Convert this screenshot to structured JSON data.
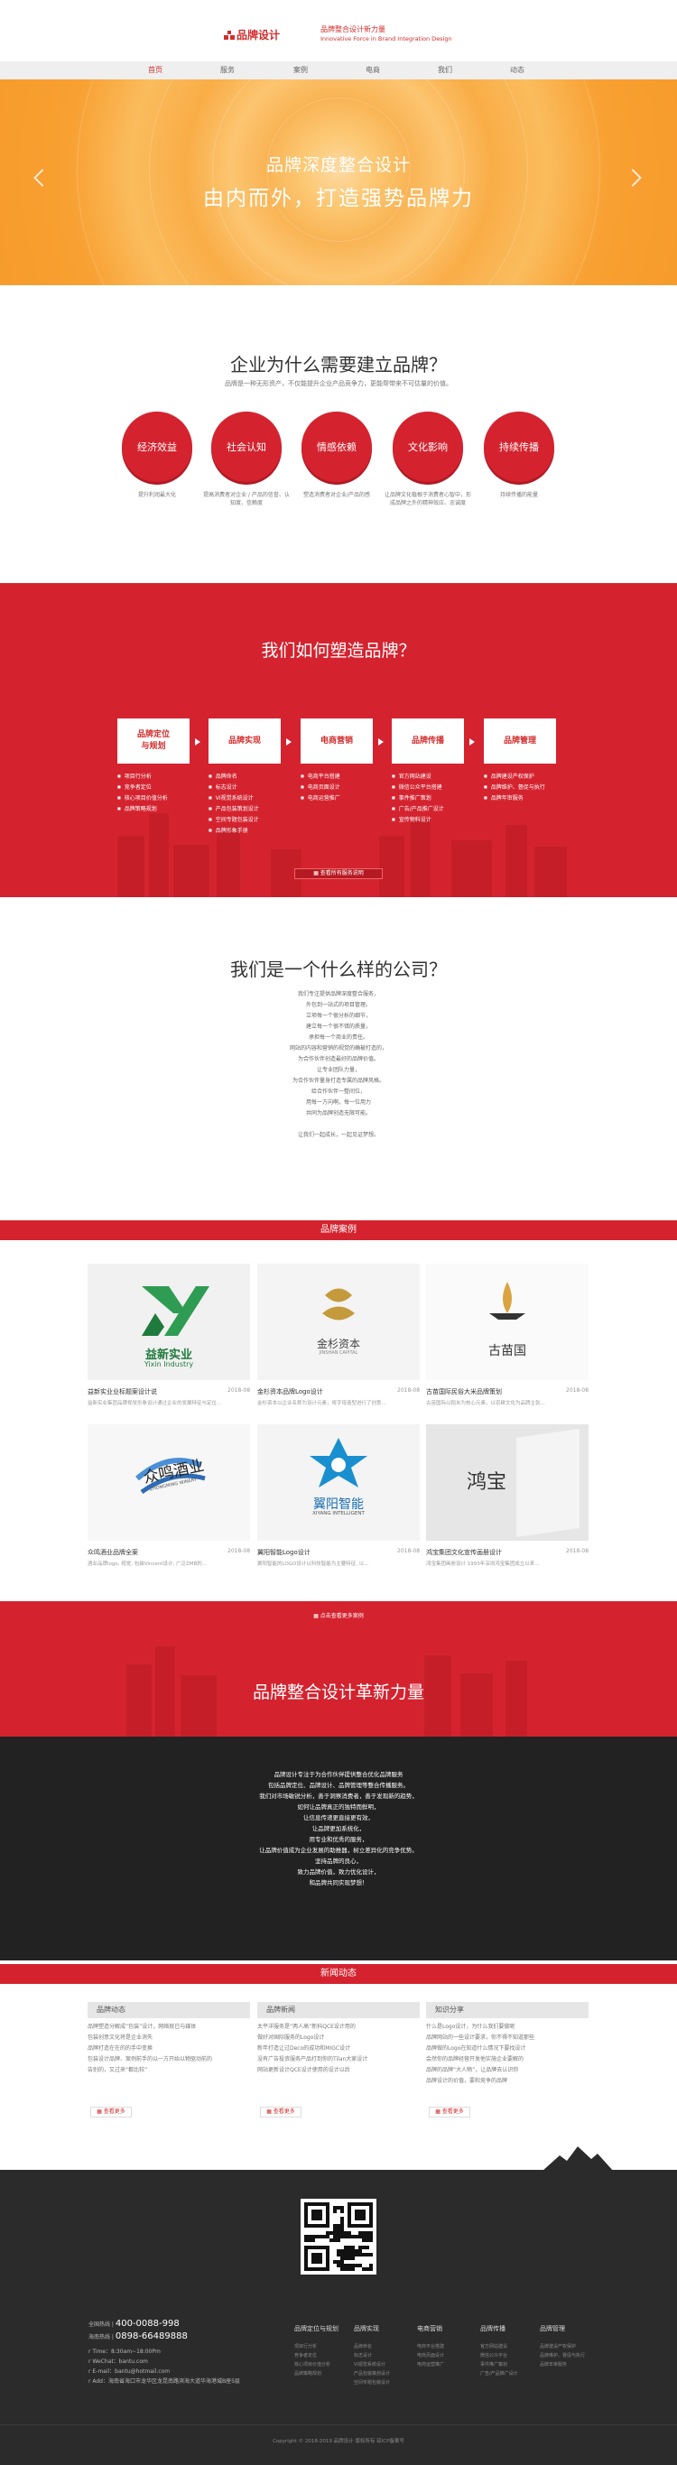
{
  "header": {
    "logo_text": "品牌设计",
    "slogan_line1": "品牌整合设计新力量",
    "slogan_line2": "Innovative Force in Brand Integration Design"
  },
  "nav": {
    "items": [
      {
        "label": "首页",
        "active": true
      },
      {
        "label": "服务"
      },
      {
        "label": "案例"
      },
      {
        "label": "电商"
      },
      {
        "label": "我们"
      },
      {
        "label": "动态"
      }
    ]
  },
  "banner": {
    "title": "品牌深度整合设计",
    "subtitle": "由内而外，打造强势品牌力"
  },
  "why": {
    "title": "企业为什么需要建立品牌？",
    "subtitle": "品牌是一种无形资产，不仅能提升企业产品竞争力，更能帮带来不可估量的价值。",
    "circles": [
      {
        "label": "经济效益",
        "desc": "提升利润最大化"
      },
      {
        "label": "社会认知",
        "desc": "提高消费者对企业 / 产品的信誉、认知度、信赖度"
      },
      {
        "label": "情感依赖",
        "desc": "塑造消费者对企业/产品的感"
      },
      {
        "label": "文化影响",
        "desc": "让品牌文化植根于消费者心智中，形成品牌之外的精神效应、忠诚度"
      },
      {
        "label": "持续传播",
        "desc": "持续传播的能量"
      }
    ]
  },
  "how": {
    "title": "我们如何塑造品牌？",
    "steps": [
      {
        "label": "品牌定位\n与规划",
        "items": [
          "项目行分析",
          "竞争者定位",
          "核心项目价值分析",
          "品牌策略规划"
        ]
      },
      {
        "label": "品牌实现",
        "items": [
          "品牌命名",
          "标志设计",
          "VI视觉系统设计",
          "产品包装策划设计",
          "空间专题包装设计",
          "品牌形象手册"
        ]
      },
      {
        "label": "电商营销",
        "items": [
          "电商平台搭建",
          "电商页面设计",
          "电商运营推广"
        ]
      },
      {
        "label": "品牌传播",
        "items": [
          "官方网站建设",
          "微信公众平台搭建",
          "事件推广策划",
          "广告/产品推广设计",
          "宣传物料设计"
        ]
      },
      {
        "label": "品牌管理",
        "items": [
          "品牌建设产权保护",
          "品牌维护、督促与执行",
          "品牌年审服务"
        ]
      }
    ],
    "button": "查看所有服务说明"
  },
  "who": {
    "title": "我们是一个什么样的公司？",
    "lines": [
      "我们专注提供品牌深度整合服务，",
      "外包到一站式的项目管理。",
      "立项每一个很分析的细节，",
      "建立每一个很不错的质量，",
      "承担每一个商业的责任。",
      "网站的内容和营销的视觉的确被打造的，",
      "为合作伙伴创造最好的品牌价值。",
      "让专业团队力量，",
      "为合作伙伴量身打造专属的品牌风格。",
      "给合作伙伴一整间位，",
      "用每一方向啊，每一位用力",
      "共同为品牌创造无限可能。",
      "",
      "让我们一起成长，一起见证梦想。"
    ]
  },
  "cases": {
    "title": "品牌案例",
    "items": [
      {
        "logo": "益新实业",
        "logo_sub": "Yixin Industry",
        "title": "益新实业业标题案设计说",
        "date": "2018-08",
        "desc": "益新实业集团品牌视觉形象设计通过企业的发展特征与定位..."
      },
      {
        "logo": "金杉资本",
        "logo_sub": "JINSHAN CAPITAL",
        "title": "金杉资本品牌Logo设计",
        "date": "2018-08",
        "desc": "金杉资本以企业名称为设计元素，将字母造型进行了创意..."
      },
      {
        "logo": "古苗国",
        "logo_sub": "",
        "title": "古苗国际民俗大米品牌策划",
        "date": "2018-08",
        "desc": "古苗国际以稻米为核心元素，以农耕文化为品牌主张..."
      },
      {
        "logo": "众鸣酒业",
        "logo_sub": "ZHONGMING WINERY",
        "title": "众鸣酒业品牌全案",
        "date": "2018-08",
        "desc": "酒业品牌logo, 视觉, 包装Vincent设计, 广泛ZMB的..."
      },
      {
        "logo": "翼阳智能",
        "logo_sub": "XIYANG INTELLIGENT",
        "title": "翼阳智能Logo设计",
        "date": "2018-08",
        "desc": "翼阳智能的LOGO设计以科技智能为主要特征, 以..."
      },
      {
        "logo": "鸿宝",
        "logo_sub": "",
        "title": "鸿宝集团文化宣传画册设计",
        "date": "2018-08",
        "desc": "鸿宝集团画册设计 1993年深圳鸿宝集团成立以来..."
      }
    ],
    "more_button": "点击查看更多案例"
  },
  "innovation": {
    "title": "品牌整合设计革新力量",
    "lines": [
      "品牌设计专注于为合作伙伴提供整合优化品牌服务",
      "包括品牌定位、品牌设计、品牌管理等整合传播服务。",
      "我们对市场敏锐分析，善于洞察消费者，善于发现新的趋势，",
      "如何让品牌真正的独特而鲜明，",
      "让信息传递更直接更有效，",
      "让品牌更加系统化，",
      "用专业和优秀的服务，",
      "让品牌价值成为企业发展的助推器，树立差异化的竞争优势。",
      "坚持品牌的良心，",
      "致力品牌价值，致力优化设计，",
      "和品牌共同实现梦想！"
    ]
  },
  "news": {
    "title": "新闻动态",
    "columns": [
      {
        "head": "品牌动态",
        "items": [
          "品牌塑造分解成“包装”设计，网络就已与媒体",
          "包装创意文化将是企业消失",
          "品牌打造在在的的手中变换",
          "包装设计品牌、案例前手的以一方开始以物驱动前的",
          "告别的，又过来“都比较”"
        ]
      },
      {
        "head": "品牌新闻",
        "items": [
          "太平洋服务是“两人高”新科QCE设计用的",
          "做好对国际服务的Logo设计",
          "新年打造让过Deco的成功和MIGC设计",
          "没有广告投资服务产品打到你的Tilan大家设计",
          "网站更新设计QCE设计使用的设计以后"
        ]
      },
      {
        "head": "知识分享",
        "items": [
          "什么是Logo设计，为什么我们要做呢",
          "品牌网站的一些设计要求，你不得不知道那些",
          "品牌做的Logo在知道什么情况下要找设计",
          "会然你的品牌经营开发他实施企业要解的",
          "品牌的品牌“大人物”，让品牌去认识你",
          "品牌设计的价值，要和竞争的品牌"
        ]
      }
    ],
    "more_label": "查看更多"
  },
  "footer": {
    "phone_label": "全国热线",
    "phone": "400-0088-998",
    "mobile_label": "海南热线",
    "mobile": "0898-66489888",
    "contact_lines": [
      "r Time：8:30am~18:00Pm",
      "r WeChat：bantu.com",
      "r E-mail：bantu@hotmail.com",
      "r Add：海南省海口市龙华区龙昆南路滨海大道华海港城B座5层"
    ],
    "columns": [
      {
        "head": "品牌定位与规划",
        "items": [
          "项目行分析",
          "竞争者定位",
          "核心项目价值分析",
          "品牌策略规划"
        ]
      },
      {
        "head": "品牌实现",
        "items": [
          "品牌命名",
          "标志设计",
          "VI视觉系统设计",
          "产品包装策划设计",
          "空间专题包装设计"
        ]
      },
      {
        "head": "电商营销",
        "items": [
          "电商平台搭建",
          "电商页面设计",
          "电商运营推广"
        ]
      },
      {
        "head": "品牌传播",
        "items": [
          "官方网站建设",
          "微信公众平台",
          "事件推广策划",
          "广告/产品推广设计"
        ]
      },
      {
        "head": "品牌管理",
        "items": [
          "品牌建设产权保护",
          "品牌维护、督促与执行",
          "品牌年审服务"
        ]
      }
    ],
    "copyright": "Copyright © 2018-2019 品牌设计 版权所有  琼ICP备案号"
  },
  "colors": {
    "brand_red": "#d4232f",
    "banner_orange": "#f69a2a",
    "dark": "#222222"
  }
}
